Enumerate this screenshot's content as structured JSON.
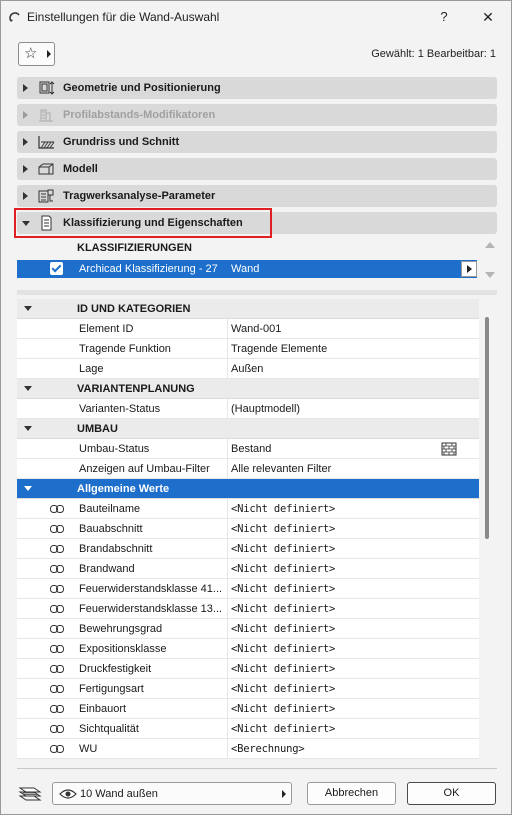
{
  "window": {
    "title": "Einstellungen für die Wand-Auswahl",
    "help_label": "?",
    "close_label": "✕"
  },
  "toolbar": {
    "favorites_icon": "star-icon",
    "selection_info": "Gewählt: 1 Bearbeitbar: 1"
  },
  "panels": [
    {
      "label": "Geometrie und Positionierung",
      "icon": "geometry-icon",
      "expanded": false,
      "enabled": true
    },
    {
      "label": "Profilabstands-Modifikatoren",
      "icon": "profile-modifier-icon",
      "expanded": false,
      "enabled": false
    },
    {
      "label": "Grundriss und Schnitt",
      "icon": "floorplan-section-icon",
      "expanded": false,
      "enabled": true
    },
    {
      "label": "Modell",
      "icon": "model-icon",
      "expanded": false,
      "enabled": true
    },
    {
      "label": "Tragwerksanalyse-Parameter",
      "icon": "structural-analysis-icon",
      "expanded": false,
      "enabled": true
    },
    {
      "label": "Klassifizierung und Eigenschaften",
      "icon": "document-icon",
      "expanded": true,
      "enabled": true
    }
  ],
  "classifications": {
    "heading": "KLASSIFIZIERUNGEN",
    "row": {
      "name": "Archicad Klassifizierung - 27",
      "value": "Wand",
      "checked": true
    }
  },
  "properties": {
    "groups": [
      {
        "label": "ID UND KATEGORIEN",
        "rows": [
          {
            "name": "Element ID",
            "value": "Wand-001"
          },
          {
            "name": "Tragende Funktion",
            "value": "Tragende Elemente"
          },
          {
            "name": "Lage",
            "value": "Außen"
          }
        ]
      },
      {
        "label": "VARIANTENPLANUNG",
        "rows": [
          {
            "name": "Varianten-Status",
            "value": "(Hauptmodell)"
          }
        ]
      },
      {
        "label": "UMBAU",
        "rows": [
          {
            "name": "Umbau-Status",
            "value": "Bestand"
          },
          {
            "name": "Anzeigen auf Umbau-Filter",
            "value": "Alle relevanten Filter"
          }
        ]
      },
      {
        "label": "Allgemeine Werte",
        "selected": true,
        "rows": [
          {
            "name": "Bauteilname",
            "value": "<Nicht definiert>"
          },
          {
            "name": "Bauabschnitt",
            "value": "<Nicht definiert>"
          },
          {
            "name": "Brandabschnitt",
            "value": "<Nicht definiert>"
          },
          {
            "name": "Brandwand",
            "value": "<Nicht definiert>"
          },
          {
            "name": "Feuerwiderstandsklasse 41...",
            "value": "<Nicht definiert>"
          },
          {
            "name": "Feuerwiderstandsklasse 13...",
            "value": "<Nicht definiert>"
          },
          {
            "name": "Bewehrungsgrad",
            "value": "<Nicht definiert>"
          },
          {
            "name": "Expositionsklasse",
            "value": "<Nicht definiert>"
          },
          {
            "name": "Druckfestigkeit",
            "value": "<Nicht definiert>"
          },
          {
            "name": "Fertigungsart",
            "value": "<Nicht definiert>"
          },
          {
            "name": "Einbauort",
            "value": "<Nicht definiert>"
          },
          {
            "name": "Sichtqualität",
            "value": "<Nicht definiert>"
          },
          {
            "name": "WU",
            "value": "<Berechnung>"
          }
        ]
      }
    ]
  },
  "footer": {
    "view_label": "10 Wand außen",
    "cancel_label": "Abbrechen",
    "ok_label": "OK"
  },
  "colors": {
    "selection": "#1e6fcc",
    "highlight_box": "#e02020",
    "panel_bg": "#d9d9d9"
  }
}
